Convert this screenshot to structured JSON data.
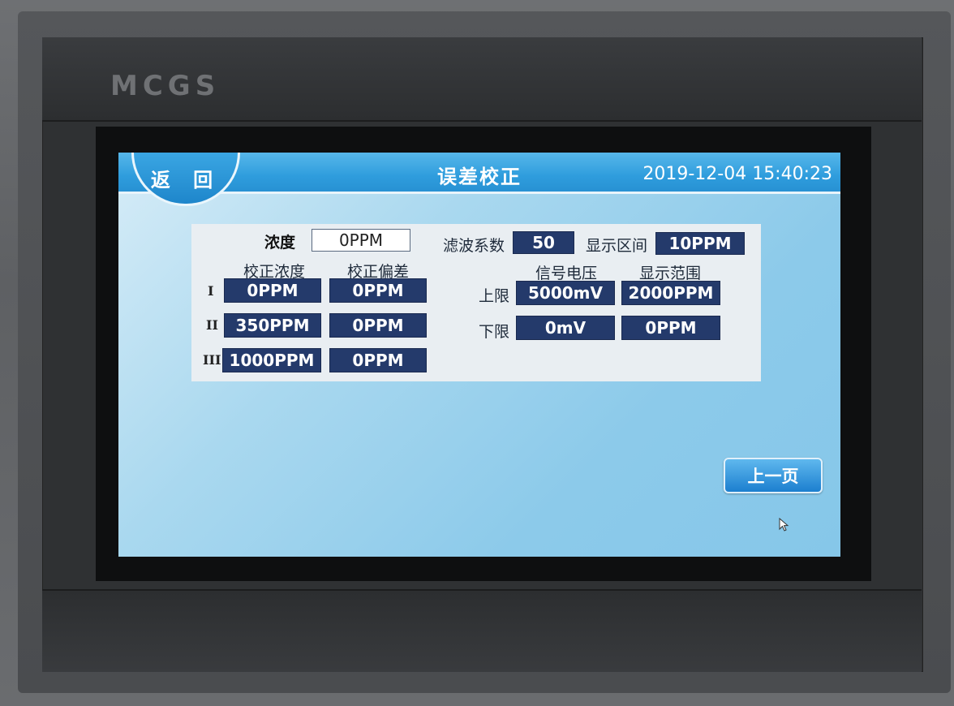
{
  "device": {
    "brand": "MCGS"
  },
  "header": {
    "back_label": "返 回",
    "title": "误差校正",
    "datetime": "2019-12-04 15:40:23"
  },
  "panel": {
    "concentration": {
      "label": "浓度",
      "value": "0PPM"
    },
    "filter": {
      "label": "滤波系数",
      "value": "50"
    },
    "display_interval": {
      "label": "显示区间",
      "value": "10PPM"
    },
    "calibration": {
      "col_concentration": "校正浓度",
      "col_deviation": "校正偏差",
      "rows": [
        {
          "roman": "I",
          "concentration": "0PPM",
          "deviation": "0PPM"
        },
        {
          "roman": "II",
          "concentration": "350PPM",
          "deviation": "0PPM"
        },
        {
          "roman": "III",
          "concentration": "1000PPM",
          "deviation": "0PPM"
        }
      ]
    },
    "limits": {
      "col_voltage": "信号电压",
      "col_range": "显示范围",
      "upper": {
        "label": "上限",
        "voltage": "5000mV",
        "range": "2000PPM"
      },
      "lower": {
        "label": "下限",
        "voltage": "0mV",
        "range": "0PPM"
      }
    }
  },
  "footer": {
    "prev_page_label": "上一页"
  },
  "icons": {
    "cursor": "mouse-cursor-icon"
  }
}
